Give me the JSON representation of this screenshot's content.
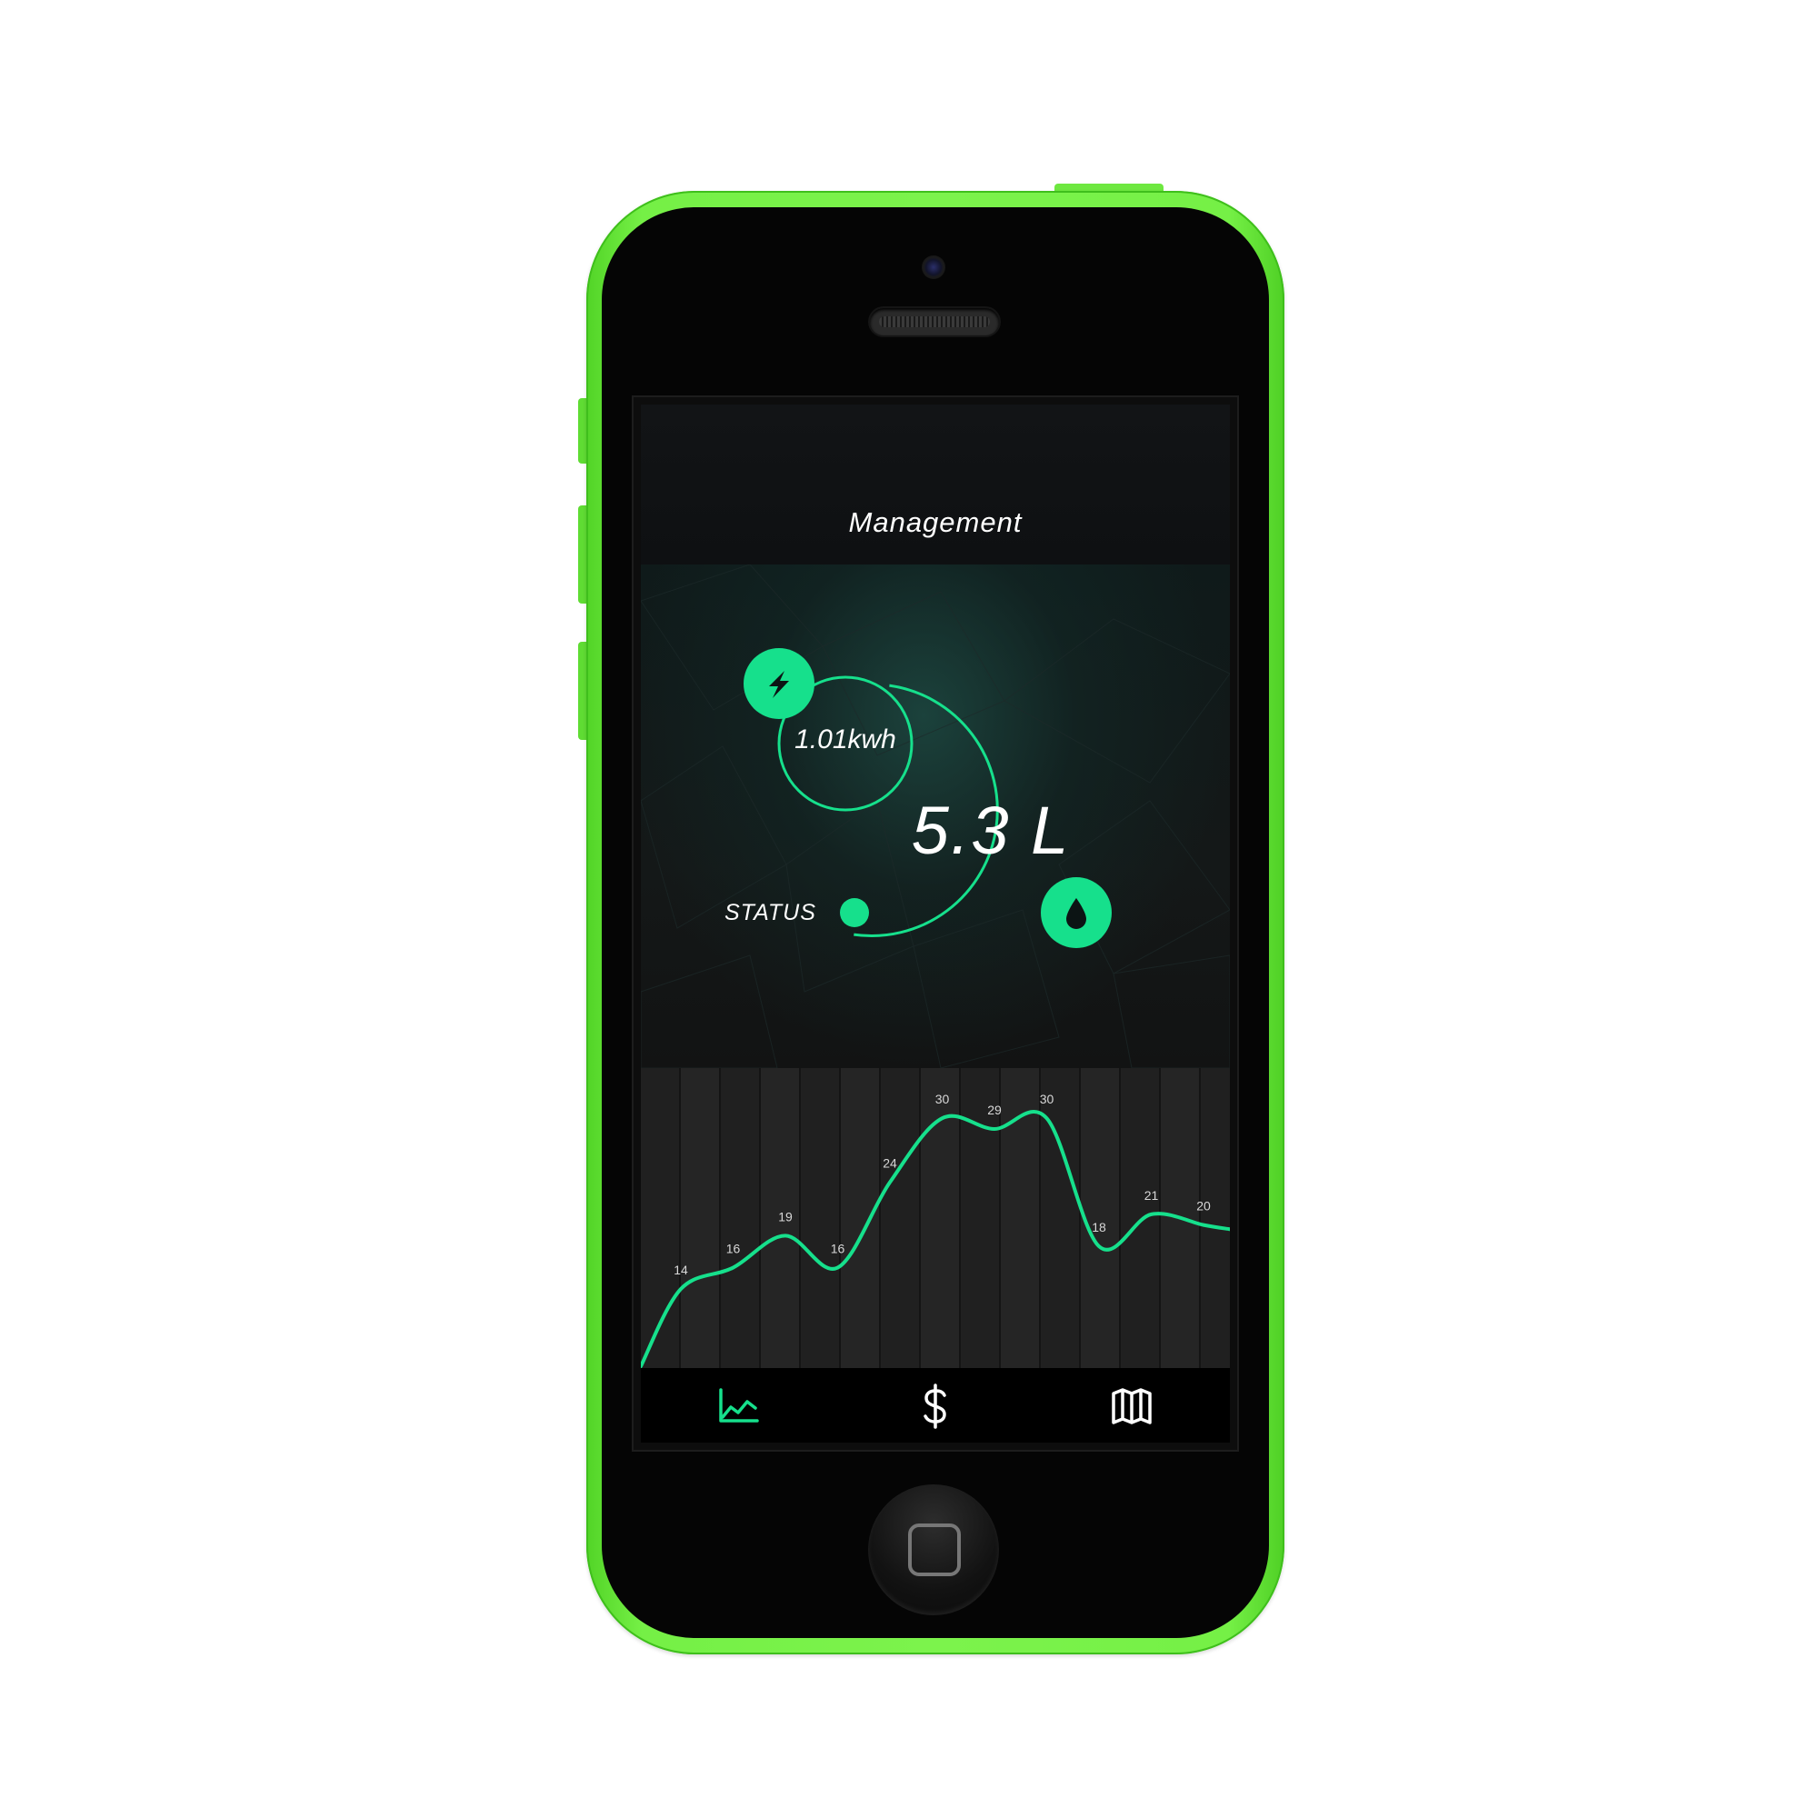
{
  "screen": {
    "header": {
      "title": "Management"
    },
    "hero": {
      "energy_value": "1.01kwh",
      "water_value": "5.3 L",
      "status_label": "STATUS",
      "energy_icon": "lightning-bolt-icon",
      "water_icon": "water-drop-icon"
    },
    "tabs": [
      {
        "icon": "line-chart-icon",
        "active": true
      },
      {
        "icon": "dollar-sign-icon",
        "active": false
      },
      {
        "icon": "map-icon",
        "active": false
      }
    ]
  },
  "colors": {
    "accent": "#16e08c",
    "shell": "#7cf34c",
    "screen_bg": "#0d0d0d",
    "text": "#ffffff"
  },
  "chart_data": {
    "type": "line",
    "values": [
      14,
      16,
      19,
      16,
      24,
      30,
      29,
      30,
      18,
      21,
      20
    ],
    "labels": [
      "14",
      "16",
      "19",
      "16",
      "24",
      "30",
      "29",
      "30",
      "18",
      "21",
      "20"
    ],
    "ylim": [
      10,
      33
    ],
    "grid": true
  }
}
